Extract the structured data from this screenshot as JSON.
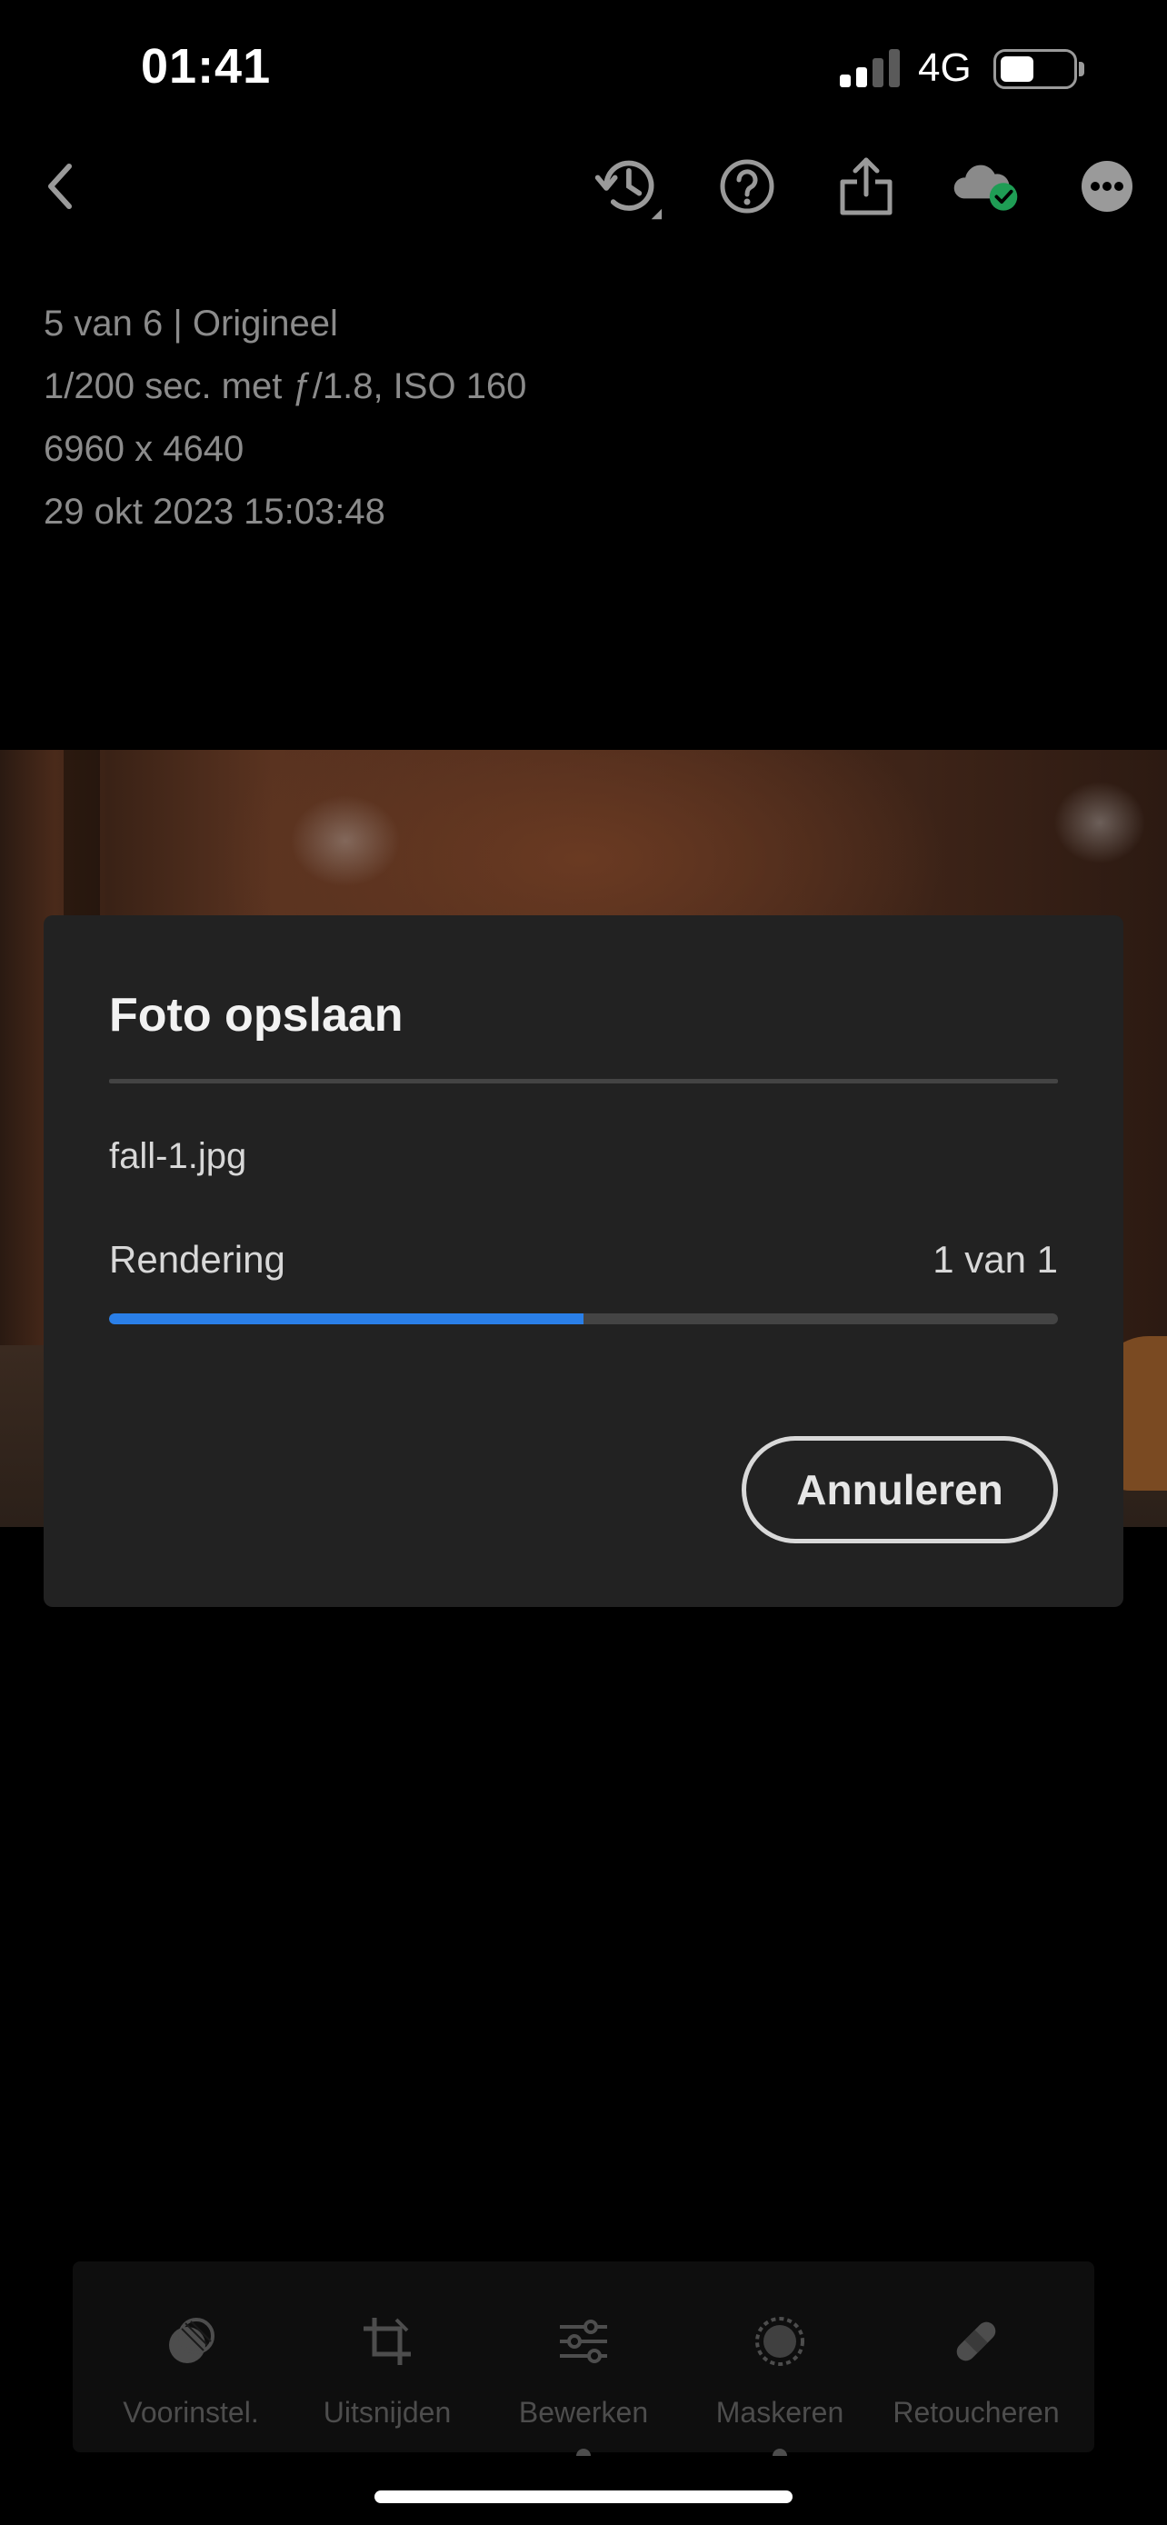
{
  "status_bar": {
    "time": "01:41",
    "network": "4G",
    "battery_level": 0.45
  },
  "toolbar": {
    "icons": [
      "back-chevron-icon",
      "history-icon",
      "help-icon",
      "share-icon",
      "cloud-synced-icon",
      "more-icon"
    ]
  },
  "photo_info": {
    "line1": "5 van 6 | Origineel",
    "line2": "1/200 sec. met ƒ/1.8, ISO 160",
    "line3": "6960 x 4640",
    "line4": "29 okt 2023 15:03:48"
  },
  "dialog": {
    "title": "Foto opslaan",
    "filename": "fall-1.jpg",
    "status_label": "Rendering",
    "count": "1 van 1",
    "progress": 0.5,
    "cancel_label": "Annuleren",
    "accent_color": "#2a7fe8"
  },
  "bottom_tools": [
    {
      "label": "Voorinstel.",
      "icon": "presets-icon"
    },
    {
      "label": "Uitsnijden",
      "icon": "crop-icon"
    },
    {
      "label": "Bewerken",
      "icon": "edit-sliders-icon"
    },
    {
      "label": "Maskeren",
      "icon": "mask-icon"
    },
    {
      "label": "Retoucheren",
      "icon": "heal-bandage-icon"
    }
  ]
}
